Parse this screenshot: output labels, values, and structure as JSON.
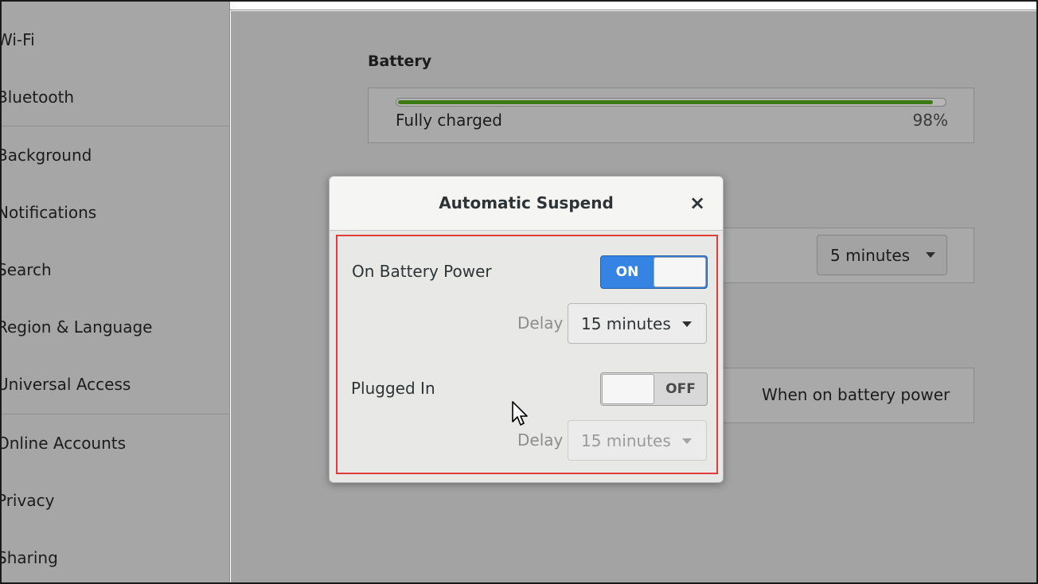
{
  "sidebar": {
    "items": [
      {
        "label": "Wi-Fi"
      },
      {
        "label": "Bluetooth"
      },
      {
        "label": "Background"
      },
      {
        "label": "Notifications"
      },
      {
        "label": "Search"
      },
      {
        "label": "Region & Language"
      },
      {
        "label": "Universal Access"
      },
      {
        "label": "Online Accounts"
      },
      {
        "label": "Privacy"
      },
      {
        "label": "Sharing"
      }
    ]
  },
  "main": {
    "battery_title": "Battery",
    "battery_status": "Fully charged",
    "battery_percent": "98%",
    "battery_level": 0.98,
    "suspend_combo": "5 minutes",
    "battery_power_button": "When on battery power"
  },
  "dialog": {
    "title": "Automatic Suspend",
    "close_glyph": "×",
    "battery_row": {
      "label": "On Battery Power",
      "switch_state": "ON",
      "delay_label": "Delay",
      "delay_value": "15 minutes"
    },
    "plugged_row": {
      "label": "Plugged In",
      "switch_state": "OFF",
      "delay_label": "Delay",
      "delay_value": "15 minutes"
    }
  },
  "colors": {
    "accent": "#3584e4",
    "highlight": "#e33b3b",
    "battery_fill": "#3c7a14"
  }
}
